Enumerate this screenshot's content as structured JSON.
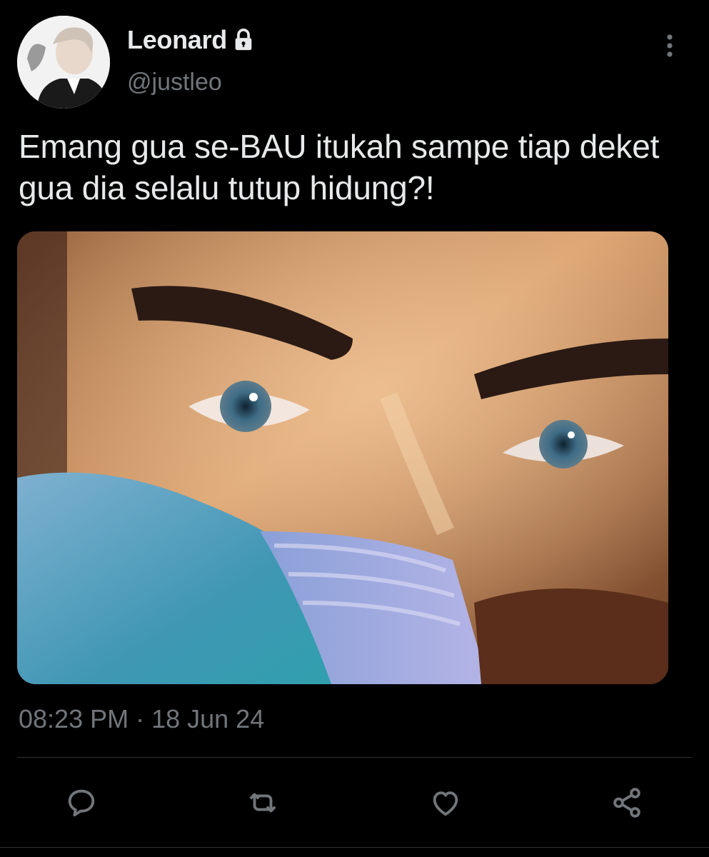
{
  "tweet": {
    "display_name": "Leonard",
    "handle": "@justleo",
    "protected_icon": "lock-icon",
    "text": "Emang gua se-BAU itukah sampe tiap deket gua dia selalu tutup hidung?!",
    "time": "08:23 PM",
    "separator": "·",
    "date": "18 Jun 24"
  },
  "media": {
    "description_icon": "photo"
  },
  "actions": [
    {
      "icon": "reply-icon"
    },
    {
      "icon": "retweet-icon"
    },
    {
      "icon": "like-icon"
    },
    {
      "icon": "share-icon"
    }
  ],
  "colors": {
    "background": "#000000",
    "primary_text": "#e7e9ea",
    "secondary_text": "#71767b",
    "divider": "#2f3336"
  }
}
